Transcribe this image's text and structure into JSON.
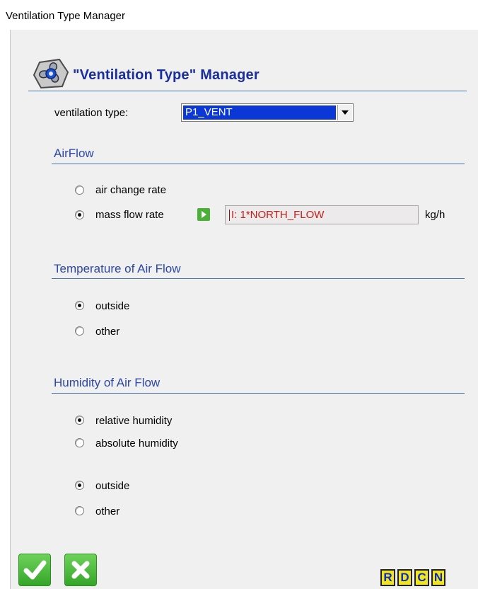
{
  "window": {
    "title": "Ventilation Type Manager"
  },
  "header": {
    "title": "\"Ventilation Type\" Manager",
    "icon": "fan-icon"
  },
  "ventilation": {
    "label": "ventilation type:",
    "selected": "P1_VENT"
  },
  "airflow": {
    "title": "AirFlow",
    "options": [
      "air change rate",
      "mass flow rate"
    ],
    "selected": "mass flow rate",
    "value": "I: 1*NORTH_FLOW",
    "unit": "kg/h"
  },
  "temperature": {
    "title": "Temperature of Air Flow",
    "options": [
      "outside",
      "other"
    ],
    "selected": "outside"
  },
  "humidity": {
    "title": "Humidity of Air Flow",
    "type_options": [
      "relative humidity",
      "absolute humidity"
    ],
    "type_selected": "relative humidity",
    "source_options": [
      "outside",
      "other"
    ],
    "source_selected": "outside"
  },
  "footer": {
    "ok_icon": "check-icon",
    "cancel_icon": "x-icon",
    "buttons": [
      "R",
      "D",
      "C",
      "N"
    ]
  },
  "colors": {
    "section_title": "#2c47a6",
    "header_title": "#1a2f9e",
    "selection": "#0a37d6",
    "field_text": "#c0201b",
    "ok_green": "#4caf38",
    "rdcn_yellow": "#f2e51e"
  }
}
